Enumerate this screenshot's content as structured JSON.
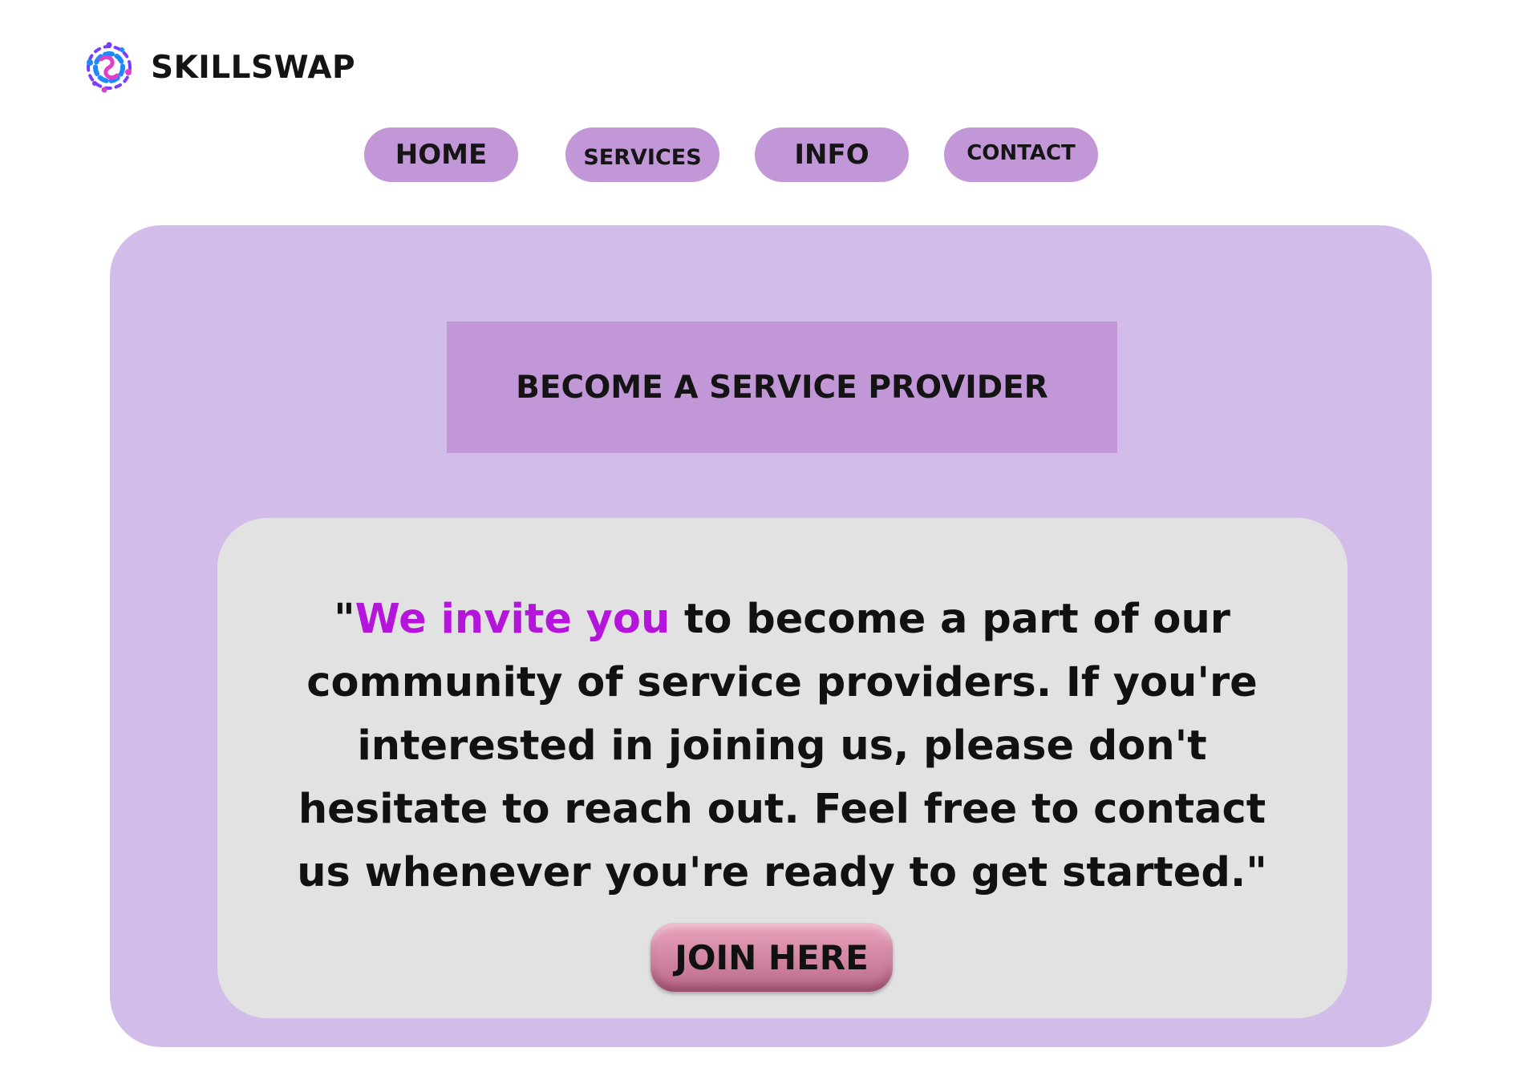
{
  "brand": {
    "name": "SKILLSWAP",
    "logo_icon": "interlinked-dots-logo-icon",
    "logo_colors": [
      "#1e88ff",
      "#7a3cff",
      "#e040c8"
    ]
  },
  "nav": {
    "items": [
      {
        "label": "HOME"
      },
      {
        "label": "SERVICES"
      },
      {
        "label": "INFO"
      },
      {
        "label": "CONTACT"
      }
    ]
  },
  "main": {
    "banner_title": "BECOME A SERVICE PROVIDER",
    "invite": {
      "open_quote": "\"",
      "highlight": "We invite you",
      "text": " to become a part of our community of service providers. If you're interested in joining us, please don't hesitate to reach out. Feel free to contact us whenever you're ready to get started.\""
    },
    "join_button": "JOIN HERE"
  },
  "colors": {
    "nav_button": "#c197d7",
    "outer_panel": "#d2bdea",
    "banner": "#c197d7",
    "inner_panel": "#e2e2e2",
    "highlight_text": "#b515db",
    "join_button": "#d58aa7"
  }
}
